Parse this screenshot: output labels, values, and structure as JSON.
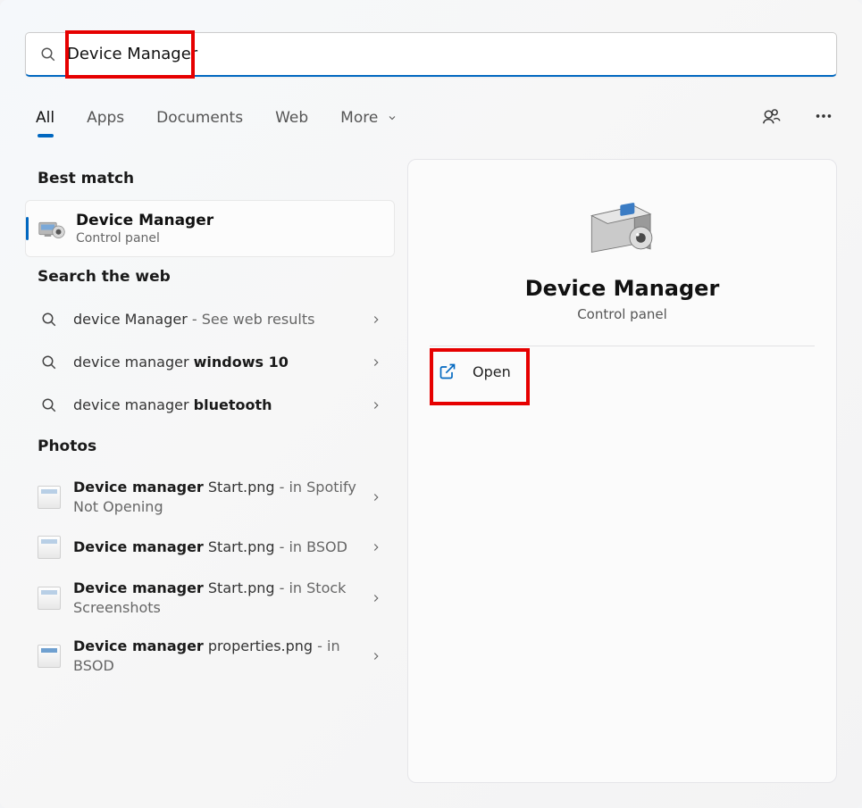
{
  "search": {
    "query": "Device Manager"
  },
  "tabs": {
    "all": "All",
    "apps": "Apps",
    "documents": "Documents",
    "web": "Web",
    "more": "More"
  },
  "sections": {
    "best_match": "Best match",
    "search_web": "Search the web",
    "photos": "Photos"
  },
  "best_match_item": {
    "title": "Device Manager",
    "subtitle": "Control panel"
  },
  "web_results": [
    {
      "prefix": "device Manager",
      "suffix": " - See web results",
      "bold_part": ""
    },
    {
      "prefix": "device manager ",
      "suffix": "",
      "bold_part": "windows 10"
    },
    {
      "prefix": "device manager ",
      "suffix": "",
      "bold_part": "bluetooth"
    }
  ],
  "photo_results": [
    {
      "bold": "Device manager",
      "rest": " Start.png",
      "in": " - in Spotify Not Opening"
    },
    {
      "bold": "Device manager",
      "rest": " Start.png",
      "in": " - in BSOD"
    },
    {
      "bold": "Device manager",
      "rest": " Start.png",
      "in": " - in Stock Screenshots"
    },
    {
      "bold": "Device manager",
      "rest": " properties.png",
      "in": " - in BSOD"
    }
  ],
  "detail": {
    "title": "Device Manager",
    "subtitle": "Control panel",
    "open": "Open"
  }
}
